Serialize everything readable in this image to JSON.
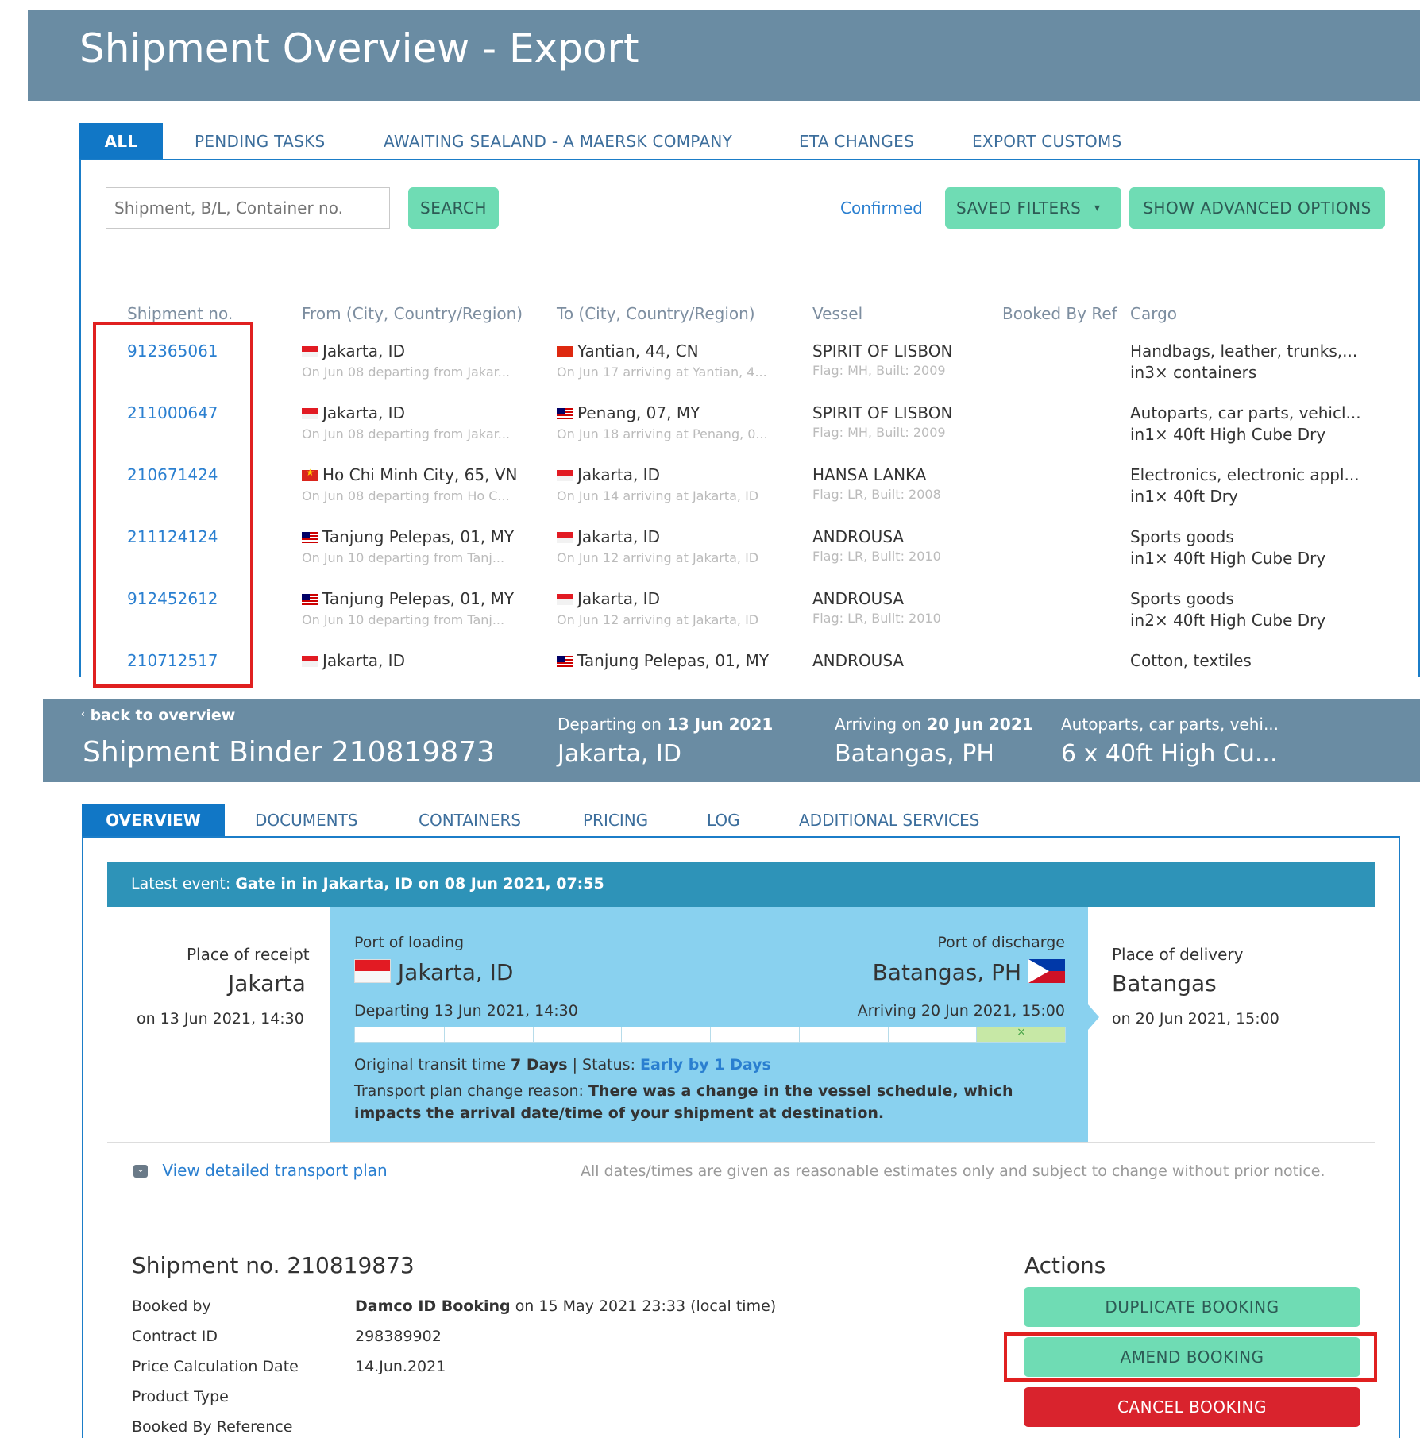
{
  "overview": {
    "title": "Shipment Overview - Export",
    "tabs": [
      "ALL",
      "PENDING TASKS",
      "AWAITING SEALAND - A MAERSK COMPANY",
      "ETA CHANGES",
      "EXPORT CUSTOMS"
    ],
    "search": {
      "placeholder": "Shipment, B/L, Container no.",
      "button": "SEARCH"
    },
    "filter_status": "Confirmed",
    "saved_filters_label": "SAVED FILTERS",
    "advanced_label": "SHOW ADVANCED OPTIONS",
    "columns": [
      "Shipment no.",
      "From (City, Country/Region)",
      "To (City, Country/Region)",
      "Vessel",
      "Booked By Ref",
      "Cargo"
    ],
    "rows": [
      {
        "id": "912365061",
        "from": "Jakarta, ID",
        "from_flag": "flag-id",
        "from_sub": "On Jun 08 departing from Jakar...",
        "to": "Yantian, 44, CN",
        "to_flag": "flag-cn",
        "to_sub": "On Jun 17 arriving at Yantian, 4...",
        "vessel": "SPIRIT OF LISBON",
        "vessel_sub": "Flag: MH, Built: 2009",
        "cargo": "Handbags, leather, trunks,...",
        "cargo_sub": "in3× containers"
      },
      {
        "id": "211000647",
        "from": "Jakarta, ID",
        "from_flag": "flag-id",
        "from_sub": "On Jun 08 departing from Jakar...",
        "to": "Penang, 07, MY",
        "to_flag": "flag-my",
        "to_sub": "On Jun 18 arriving at Penang, 0...",
        "vessel": "SPIRIT OF LISBON",
        "vessel_sub": "Flag: MH, Built: 2009",
        "cargo": "Autoparts, car parts, vehicl...",
        "cargo_sub": "in1× 40ft High Cube Dry"
      },
      {
        "id": "210671424",
        "from": "Ho Chi Minh City, 65, VN",
        "from_flag": "flag-vn",
        "from_sub": "On Jun 08 departing from Ho C...",
        "to": "Jakarta, ID",
        "to_flag": "flag-id",
        "to_sub": "On Jun 14 arriving at Jakarta, ID",
        "vessel": "HANSA LANKA",
        "vessel_sub": "Flag: LR, Built: 2008",
        "cargo": "Electronics, electronic appl...",
        "cargo_sub": "in1× 40ft Dry"
      },
      {
        "id": "211124124",
        "from": "Tanjung Pelepas, 01, MY",
        "from_flag": "flag-my",
        "from_sub": "On Jun 10 departing from Tanj...",
        "to": "Jakarta, ID",
        "to_flag": "flag-id",
        "to_sub": "On Jun 12 arriving at Jakarta, ID",
        "vessel": "ANDROUSA",
        "vessel_sub": "Flag: LR, Built: 2010",
        "cargo": "Sports goods",
        "cargo_sub": "in1× 40ft High Cube Dry"
      },
      {
        "id": "912452612",
        "from": "Tanjung Pelepas, 01, MY",
        "from_flag": "flag-my",
        "from_sub": "On Jun 10 departing from Tanj...",
        "to": "Jakarta, ID",
        "to_flag": "flag-id",
        "to_sub": "On Jun 12 arriving at Jakarta, ID",
        "vessel": "ANDROUSA",
        "vessel_sub": "Flag: LR, Built: 2010",
        "cargo": "Sports goods",
        "cargo_sub": "in2× 40ft High Cube Dry"
      },
      {
        "id": "210712517",
        "from": "Jakarta, ID",
        "from_flag": "flag-id",
        "from_sub": "",
        "to": "Tanjung Pelepas, 01, MY",
        "to_flag": "flag-my",
        "to_sub": "",
        "vessel": "ANDROUSA",
        "vessel_sub": "",
        "cargo": "Cotton, textiles",
        "cargo_sub": ""
      }
    ]
  },
  "binder": {
    "back": "back to overview",
    "title": "Shipment Binder 210819873",
    "departing_label": "Departing on",
    "departing_date": "13 Jun 2021",
    "departing_place": "Jakarta, ID",
    "arriving_label": "Arriving on",
    "arriving_date": "20 Jun 2021",
    "arriving_place": "Batangas, PH",
    "cargo_short": "Autoparts, car parts, vehi...",
    "containers_short": "6 x 40ft High Cu...",
    "tabs": [
      "OVERVIEW",
      "DOCUMENTS",
      "CONTAINERS",
      "PRICING",
      "LOG",
      "ADDITIONAL SERVICES"
    ],
    "latest_event_prefix": "Latest event:",
    "latest_event": "Gate in in Jakarta, ID on 08 Jun 2021, 07:55",
    "route": {
      "receipt_label": "Place of receipt",
      "receipt_place": "Jakarta",
      "receipt_date": "on 13 Jun 2021, 14:30",
      "pol_label": "Port of loading",
      "pol_place": "Jakarta, ID",
      "pod_label": "Port of discharge",
      "pod_place": "Batangas, PH",
      "departing": "Departing 13 Jun 2021, 14:30",
      "arriving": "Arriving 20 Jun 2021, 15:00",
      "progress_segments": 8,
      "transit_prefix": "Original transit time",
      "transit_value": "7 Days",
      "status_prefix": "| Status:",
      "status_value": "Early by 1 Days",
      "change_prefix": "Transport plan change reason:",
      "change_reason_1": "There was a change in the vessel schedule, which",
      "change_reason_2": "impacts the arrival date/time of your shipment at destination.",
      "delivery_label": "Place of delivery",
      "delivery_place": "Batangas",
      "delivery_date": "on 20 Jun 2021, 15:00"
    },
    "view_plan": "View detailed transport plan",
    "disclaimer": "All dates/times are given as reasonable estimates only and subject to change without prior notice.",
    "details": {
      "title": "Shipment no. 210819873",
      "booked_by_label": "Booked by",
      "booked_by_value": "Damco ID Booking",
      "booked_by_suffix": "on 15 May 2021 23:33 (local time)",
      "contract_label": "Contract ID",
      "contract_value": "298389902",
      "price_date_label": "Price Calculation Date",
      "price_date_value": "14.Jun.2021",
      "product_type_label": "Product Type",
      "booked_ref_label": "Booked By Reference"
    },
    "actions": {
      "title": "Actions",
      "duplicate": "DUPLICATE BOOKING",
      "amend": "AMEND BOOKING",
      "cancel": "CANCEL BOOKING"
    }
  },
  "colors": {
    "header": "#6a8ca3",
    "tab_active": "#1177c6",
    "green_button": "#6fdcb4",
    "red_button": "#d9232d",
    "highlight": "#e02020",
    "route_bg": "#89d1ef",
    "event_bar": "#2e93b8"
  }
}
